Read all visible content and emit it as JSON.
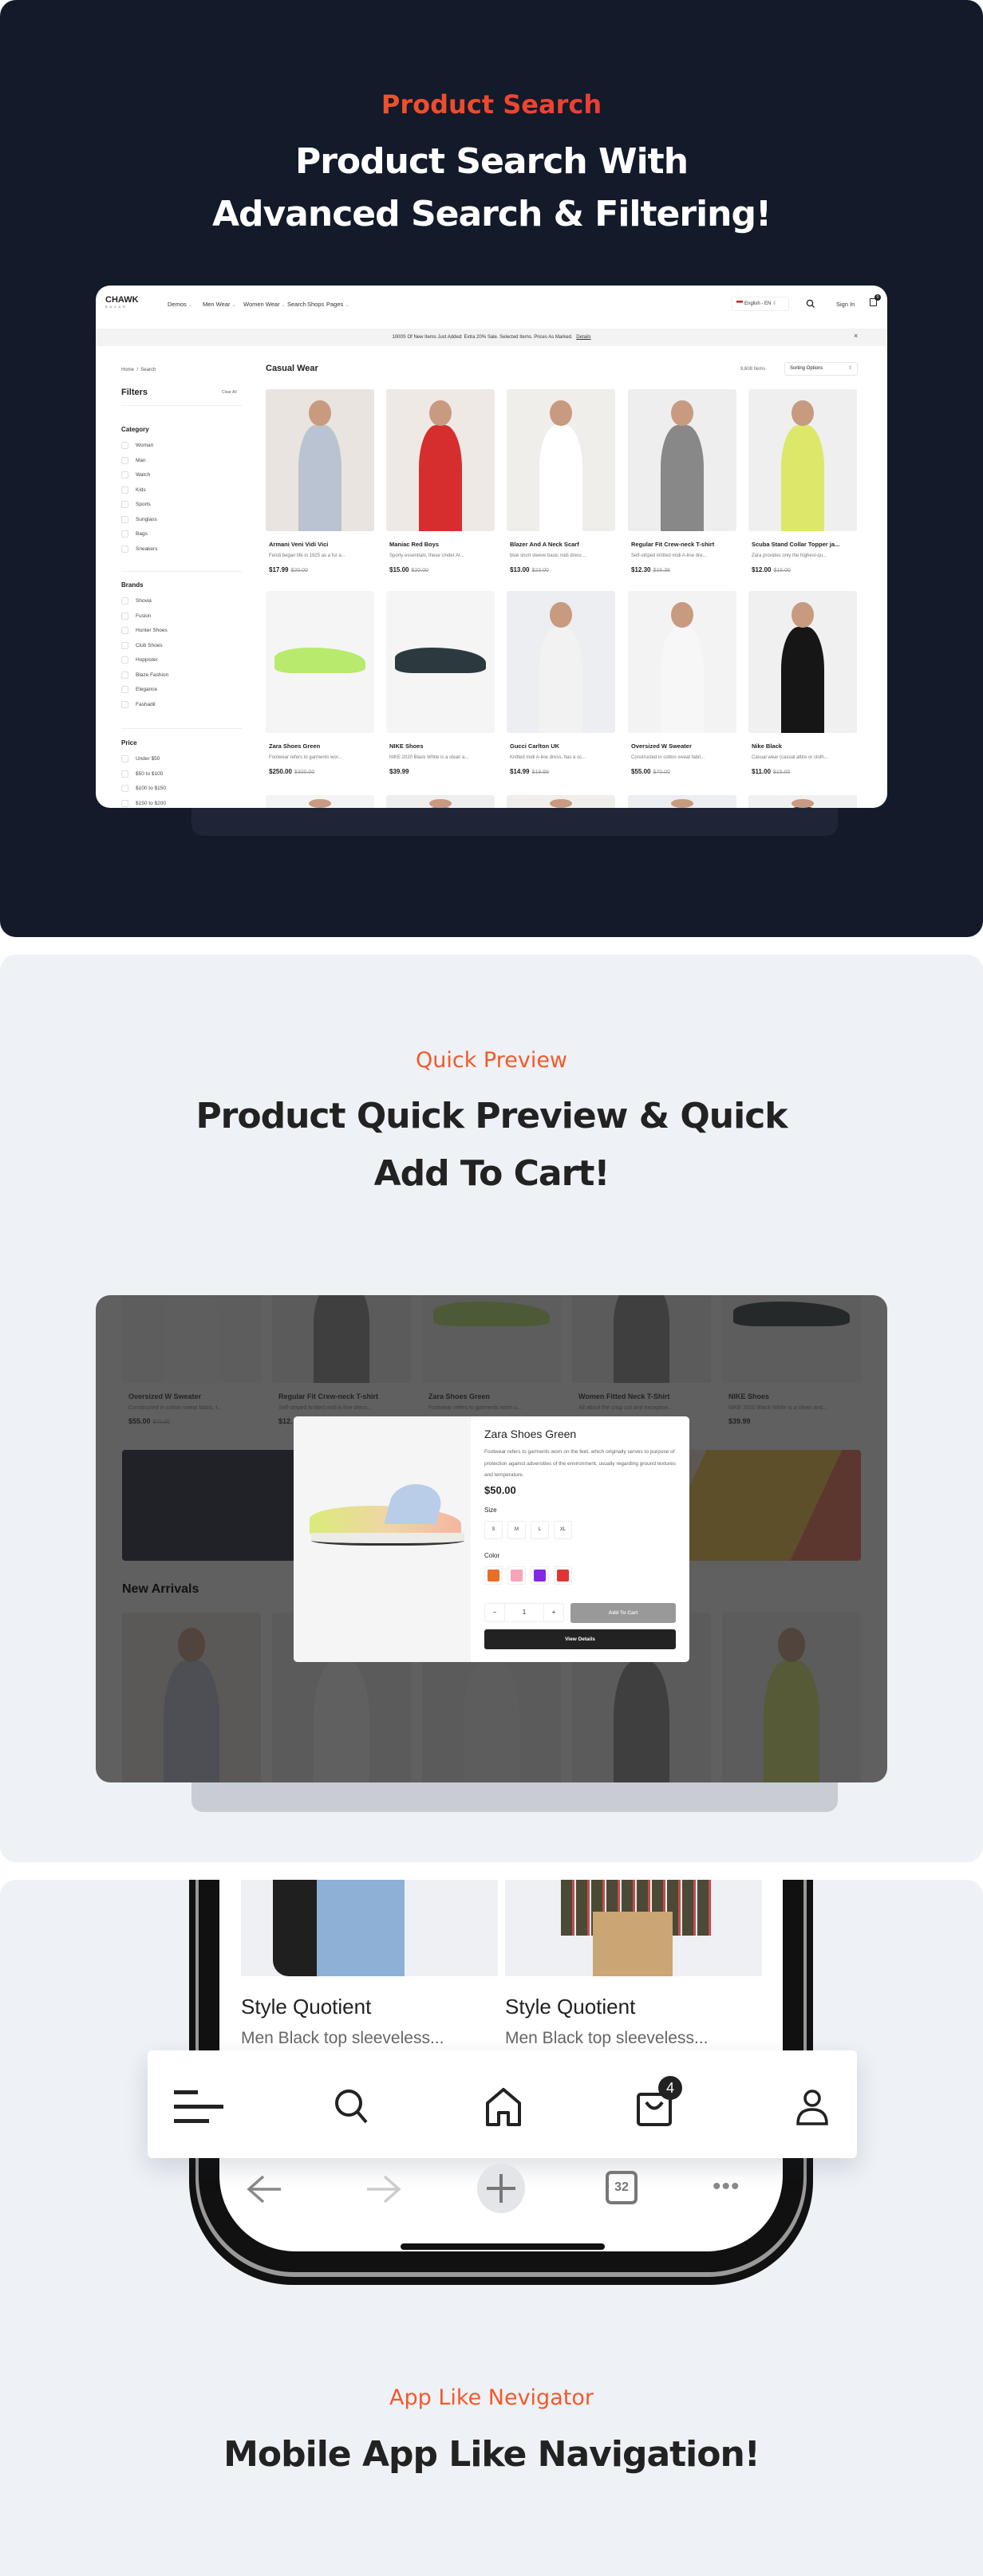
{
  "section_search": {
    "eyebrow": "Product Search",
    "headline_line1": "Product Search With",
    "headline_line2": "Advanced Search & Filtering!",
    "app": {
      "logo": "CHAWK",
      "logo_sub": "B A Z A R",
      "nav": [
        "Demos",
        "Men Wear",
        "Women Wear",
        "Search",
        "Shops",
        "Pages"
      ],
      "nav_has_dropdown": [
        true,
        true,
        true,
        false,
        false,
        true
      ],
      "language": "English - EN",
      "sign_in": "Sign In",
      "cart_count": "0",
      "announcement": "1000S Of New Items Just Added: Extra 20% Sale. Selected Items. Prices As Marked.",
      "announcement_link": "Details",
      "breadcrumb": [
        "Home",
        "Search"
      ],
      "filters_title": "Filters",
      "clear_all": "Clear All",
      "category_label": "Category",
      "categories": [
        "Woman",
        "Man",
        "Watch",
        "Kids",
        "Sports",
        "Sunglass",
        "Bags",
        "Sneakers"
      ],
      "brands_label": "Brands",
      "brands": [
        "Shovia",
        "Fusion",
        "Hunter Shoes",
        "Club Shoes",
        "Hoppister",
        "Blaze Fashion",
        "Elegance",
        "Fashadil"
      ],
      "price_label": "Price",
      "prices": [
        "Under $50",
        "$50 to $100",
        "$100 to $150",
        "$150 to $200"
      ],
      "page_title": "Casual Wear",
      "item_count": "9,608 Items",
      "sort": "Sorting Options",
      "products": [
        {
          "name": "Armani Veni Vidi Vici",
          "desc": "Fendi began life in 1925 as a fur a...",
          "price": "$17.99",
          "old": "$20.00"
        },
        {
          "name": "Maniac Red Boys",
          "desc": "Sporty essentials, these Under Ar...",
          "price": "$15.00",
          "old": "$20.00"
        },
        {
          "name": "Blazer And A Neck Scarf",
          "desc": "blue short sleeve basic midi dress ...",
          "price": "$13.00",
          "old": "$23.00"
        },
        {
          "name": "Regular Fit Crew-neck T-shirt",
          "desc": "Self-striped knitted midi A-line dre...",
          "price": "$12.30",
          "old": "$16.38"
        },
        {
          "name": "Scuba Stand Collar Topper ja...",
          "desc": "Zara provides only the highest-qu...",
          "price": "$12.00",
          "old": "$16.00"
        },
        {
          "name": "Zara Shoes Green",
          "desc": "Footwear refers to garments wor...",
          "price": "$250.00",
          "old": "$300.00"
        },
        {
          "name": "NIKE Shoes",
          "desc": "NIKE 2020 Black White is a clean a...",
          "price": "$39.99",
          "old": ""
        },
        {
          "name": "Gucci Carlton UK",
          "desc": "Knitted midi A-line dress, has a sc...",
          "price": "$14.99",
          "old": "$19.99"
        },
        {
          "name": "Oversized W Sweater",
          "desc": "Constructed in cotton sweat fabri...",
          "price": "$55.00",
          "old": "$70.00"
        },
        {
          "name": "Nike Black",
          "desc": "Casual wear (casual attire or cloth...",
          "price": "$11.00",
          "old": "$15.00"
        }
      ]
    }
  },
  "section_preview": {
    "eyebrow": "Quick Preview",
    "headline_line1": "Product Quick Preview & Quick",
    "headline_line2": "Add To Cart!",
    "bg_products": [
      {
        "name": "Oversized W Sweater",
        "desc": "Constructed in cotton sweat fabric, t...",
        "price": "$55.00",
        "old": "$70.00"
      },
      {
        "name": "Regular Fit Crew-neck T-shirt",
        "desc": "Self-striped knitted midi A-line dress...",
        "price": "$12.",
        "old": ""
      },
      {
        "name": "Zara Shoes Green",
        "desc": "Footwear refers to garments worn o...",
        "price": "",
        "old": ""
      },
      {
        "name": "Women Fitted Neck T-Shirt",
        "desc": "All about the crisp cut and exception...",
        "price": "",
        "old": ""
      },
      {
        "name": "NIKE Shoes",
        "desc": "NIKE 2020 Black White is a clean and...",
        "price": "$39.99",
        "old": ""
      }
    ],
    "new_arrivals": "New Arrivals",
    "modal": {
      "title": "Zara Shoes Green",
      "description": "Footwear refers to garments worn on the feet, which originally serves to purpose of protection against adversities of the environment, usually regarding ground textures and temperature.",
      "price": "$50.00",
      "size_label": "Size",
      "sizes": [
        "S",
        "M",
        "L",
        "XL"
      ],
      "color_label": "Color",
      "colors": [
        "#e86f24",
        "#f9a3b6",
        "#8527e6",
        "#e03535"
      ],
      "quantity": "1",
      "minus": "−",
      "plus": "+",
      "add_to_cart": "Add To Cart",
      "view_details": "View Details"
    }
  },
  "section_mobile": {
    "products": [
      {
        "name": "Style Quotient",
        "desc": "Men Black top sleeveless..."
      },
      {
        "name": "Style Quotient",
        "desc": "Men Black top sleeveless..."
      }
    ],
    "cart_badge": "4",
    "tab_count": "32",
    "eyebrow": "App Like Nevigator",
    "headline": "Mobile App Like Navigation!"
  },
  "colors": {
    "dark_bg": "#131a2a",
    "light_bg": "#eef1f6",
    "accent": "#f25a29"
  }
}
